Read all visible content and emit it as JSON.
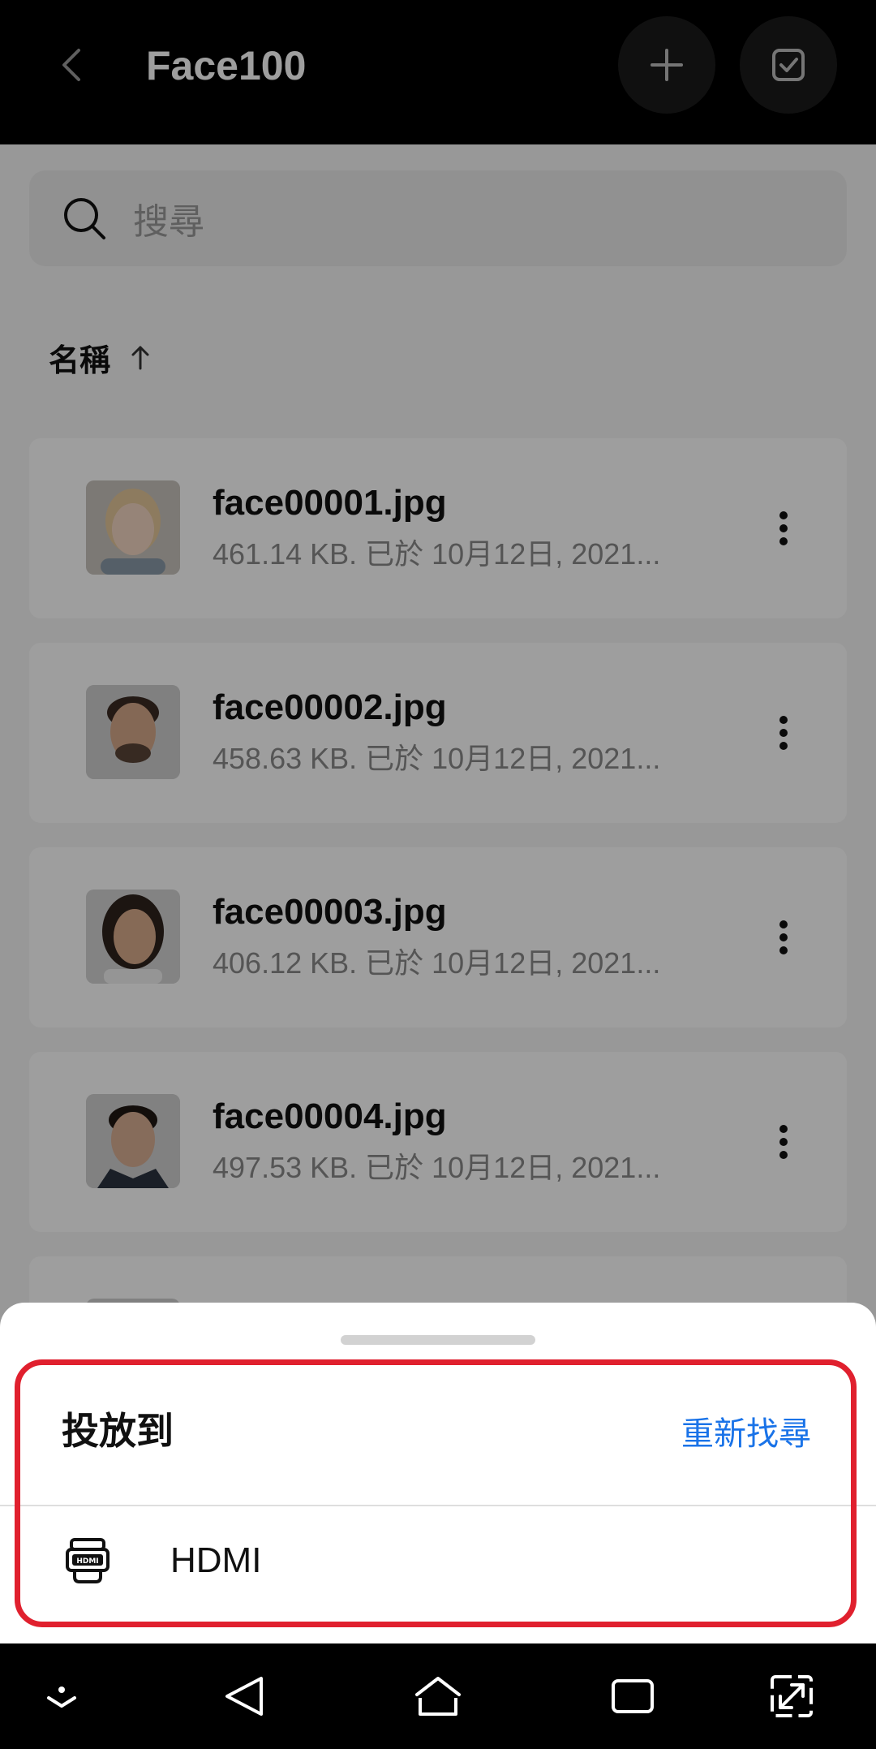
{
  "header": {
    "title": "Face100",
    "back_icon": "chevron-left-icon",
    "add_icon": "plus-icon",
    "select_icon": "checkbox-icon"
  },
  "search": {
    "placeholder": "搜尋",
    "icon": "search-icon"
  },
  "sort": {
    "label": "名稱",
    "direction_icon": "arrow-up-icon"
  },
  "files": [
    {
      "name": "face00001.jpg",
      "meta": "461.14 KB. 已於 10月12日, 2021..."
    },
    {
      "name": "face00002.jpg",
      "meta": "458.63 KB. 已於 10月12日, 2021..."
    },
    {
      "name": "face00003.jpg",
      "meta": "406.12 KB. 已於 10月12日, 2021..."
    },
    {
      "name": "face00004.jpg",
      "meta": "497.53 KB. 已於 10月12日, 2021..."
    }
  ],
  "cast_sheet": {
    "title": "投放到",
    "rescan_label": "重新找尋",
    "devices": [
      {
        "label": "HDMI",
        "icon": "hdmi-icon"
      }
    ]
  },
  "colors": {
    "accent": "#1a73e8",
    "highlight": "#e0202e"
  },
  "navbar": {
    "icons": [
      "hide-keyboard-icon",
      "back-icon",
      "home-icon",
      "recents-icon",
      "screenshot-expand-icon"
    ]
  }
}
